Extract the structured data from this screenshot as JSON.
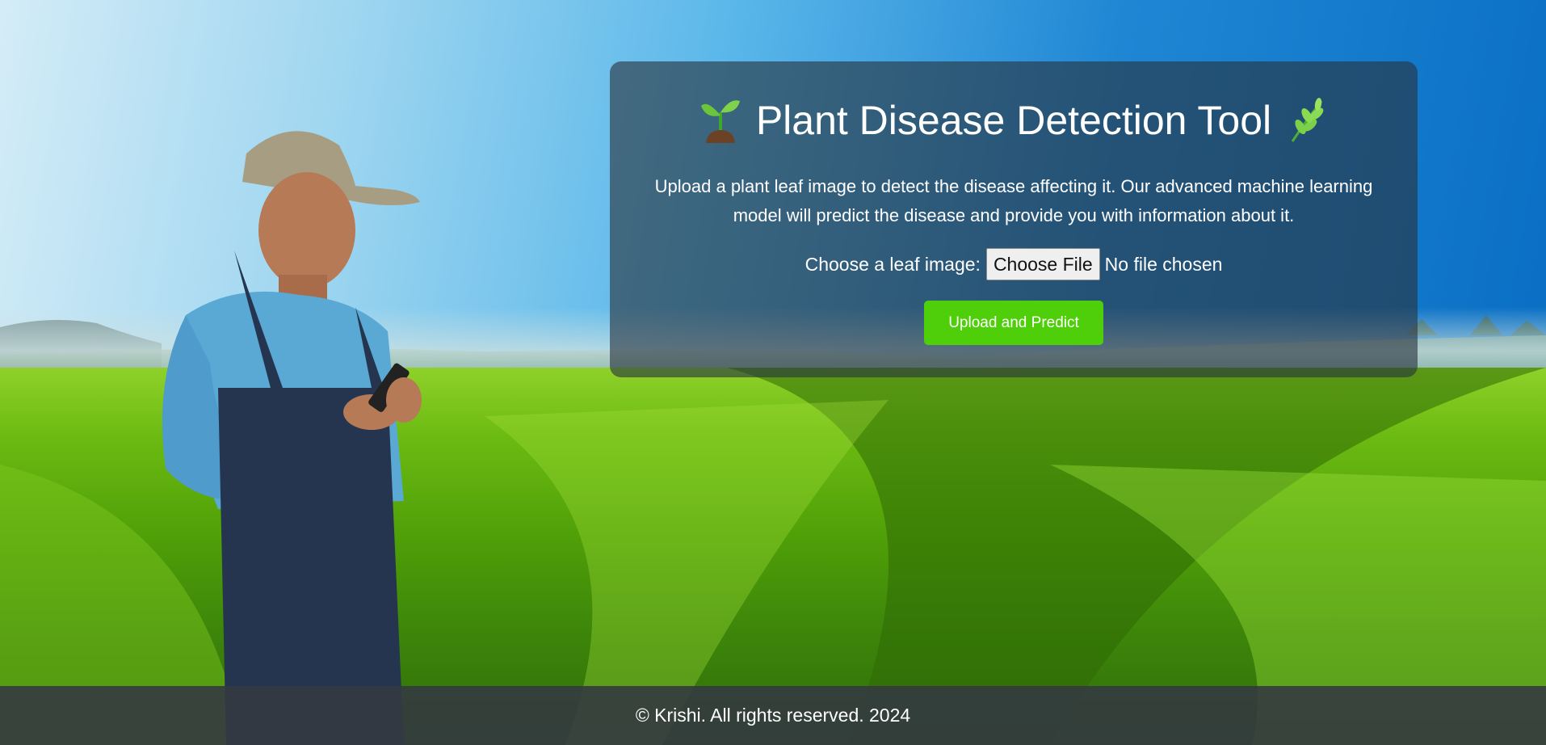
{
  "card": {
    "title": "Plant Disease Detection Tool",
    "left_icon": "seedling-icon",
    "right_icon": "herb-icon",
    "description": "Upload a plant leaf image to detect the disease affecting it. Our advanced machine learning model will predict the disease and provide you with information about it.",
    "file_label": "Choose a leaf image:",
    "choose_file_label": "Choose File",
    "file_status": "No file chosen",
    "submit_label": "Upload and Predict"
  },
  "footer": {
    "text": "© Krishi. All rights reserved. 2024"
  },
  "colors": {
    "accent": "#4fcf0a",
    "card_background": "rgba(40,52,62,0.62)",
    "footer_background": "#343a40"
  }
}
